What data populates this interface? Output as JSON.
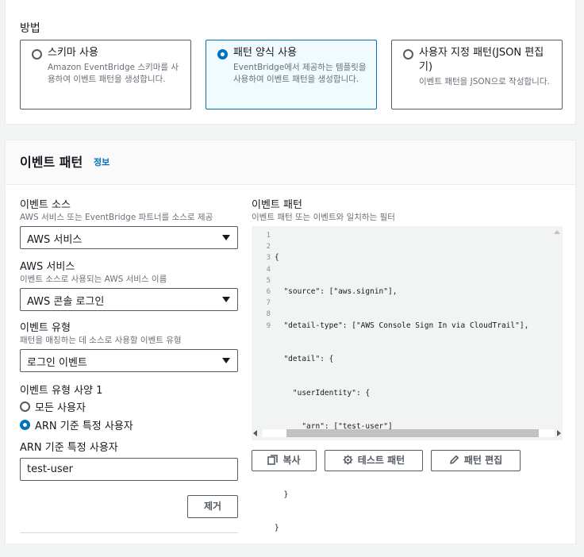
{
  "method": {
    "label": "방법",
    "options": [
      {
        "title": "스키마 사용",
        "desc": "Amazon EventBridge 스키마를 사용하여 이벤트 패턴을 생성합니다.",
        "selected": false
      },
      {
        "title": "패턴 양식 사용",
        "desc": "EventBridge에서 제공하는 템플릿을 사용하여 이벤트 패턴을 생성합니다.",
        "selected": true
      },
      {
        "title": "사용자 지정 패턴(JSON 편집기)",
        "desc": "이벤트 패턴을 JSON으로 작성합니다.",
        "selected": false
      }
    ]
  },
  "event_pattern": {
    "heading": "이벤트 패턴",
    "info_link": "정보",
    "event_source": {
      "label": "이벤트 소스",
      "desc": "AWS 서비스 또는 EventBridge 파트너를 소스로 제공",
      "value": "AWS 서비스"
    },
    "aws_service": {
      "label": "AWS 서비스",
      "desc": "이벤트 소스로 사용되는 AWS 서비스 이름",
      "value": "AWS 콘솔 로그인"
    },
    "event_type": {
      "label": "이벤트 유형",
      "desc": "패턴을 매칭하는 데 소스로 사용할 이벤트 유형",
      "value": "로그인 이벤트"
    },
    "type_spec": {
      "label": "이벤트 유형 사양 1",
      "options": [
        {
          "label": "모든 사용자",
          "selected": false
        },
        {
          "label": "ARN 기준 특정 사용자",
          "selected": true
        }
      ]
    },
    "arn_users": {
      "label": "ARN 기준 특정 사용자",
      "value": "test-user"
    },
    "remove_button": "제거",
    "pattern_panel": {
      "label": "이벤트 패턴",
      "desc": "이벤트 패턴 또는 이벤트와 일치하는 필터",
      "line_numbers": [
        "1",
        "2",
        "3",
        "4",
        "5",
        "6",
        "7",
        "8",
        "9"
      ],
      "lines": [
        "{",
        "  \"source\": [\"aws.signin\"],",
        "  \"detail-type\": [\"AWS Console Sign In via CloudTrail\"],",
        "  \"detail\": {",
        "    \"userIdentity\": {",
        "      \"arn\": [\"test-user\"]",
        "    }",
        "  }",
        "}"
      ]
    },
    "actions": {
      "copy": "복사",
      "test": "테스트 패턴",
      "edit": "패턴 편집"
    }
  },
  "colors": {
    "accent": "#0073bb",
    "border": "#545b64",
    "muted": "#687078",
    "page_bg": "#f2f3f3"
  },
  "icons": {
    "copy": "copy-icon",
    "test": "gear-icon",
    "edit": "pencil-icon"
  }
}
